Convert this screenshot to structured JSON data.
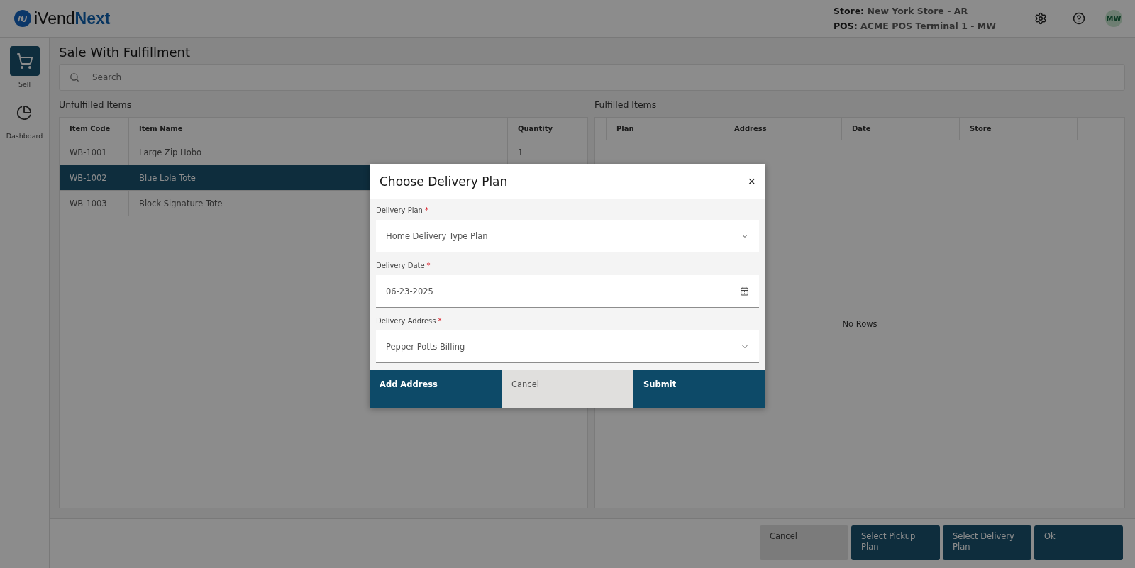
{
  "header": {
    "logo": {
      "prefix": "iVend",
      "suffix": "Next"
    },
    "store": {
      "label": "Store:",
      "value": "New York Store - AR"
    },
    "pos": {
      "label": "POS:",
      "value": "ACME POS Terminal 1 - MW"
    },
    "avatar": "MW"
  },
  "sidebar": {
    "items": [
      {
        "label": "Sell",
        "kind": "cart",
        "selected": true
      },
      {
        "label": "Dashboard",
        "kind": "chart",
        "selected": false
      }
    ]
  },
  "page": {
    "title": "Sale With Fulfillment",
    "search": {
      "placeholder": "Search"
    }
  },
  "unfulfilled": {
    "title": "Unfulfilled Items",
    "columns": [
      "Item Code",
      "Item Name",
      "Quantity"
    ],
    "rows": [
      {
        "cells": [
          "WB-1001",
          "Large Zip Hobo",
          "1"
        ],
        "selected": false
      },
      {
        "cells": [
          "WB-1002",
          "Blue Lola Tote"
        ],
        "selected": true
      },
      {
        "cells": [
          "WB-1003",
          "Block Signature Tote"
        ],
        "selected": false
      }
    ]
  },
  "fulfilled": {
    "title": "Fulfilled Items",
    "columns": [
      "Plan",
      "Address",
      "Date",
      "Store"
    ],
    "empty_text": "No Rows"
  },
  "footer_buttons": [
    {
      "label": "Cancel",
      "kind": "secondary"
    },
    {
      "label": "Select Pickup Plan",
      "kind": "primary"
    },
    {
      "label": "Select Delivery Plan",
      "kind": "primary"
    },
    {
      "label": "Ok",
      "kind": "primary"
    }
  ],
  "dialog": {
    "title": "Choose Delivery Plan",
    "close": "×",
    "fields": [
      {
        "label": "Delivery Plan",
        "required_mark": "*",
        "kind": "select",
        "value": "Home Delivery Type Plan"
      },
      {
        "label": "Delivery Date",
        "required_mark": "*",
        "kind": "date",
        "value": "06-23-2025"
      },
      {
        "label": "Delivery Address",
        "required_mark": "*",
        "kind": "select",
        "value": "Pepper Potts-Billing"
      }
    ],
    "buttons": [
      {
        "label": "Add Address",
        "kind": "primary"
      },
      {
        "label": "Cancel",
        "kind": "secondary"
      },
      {
        "label": "Submit",
        "kind": "primary"
      }
    ]
  }
}
